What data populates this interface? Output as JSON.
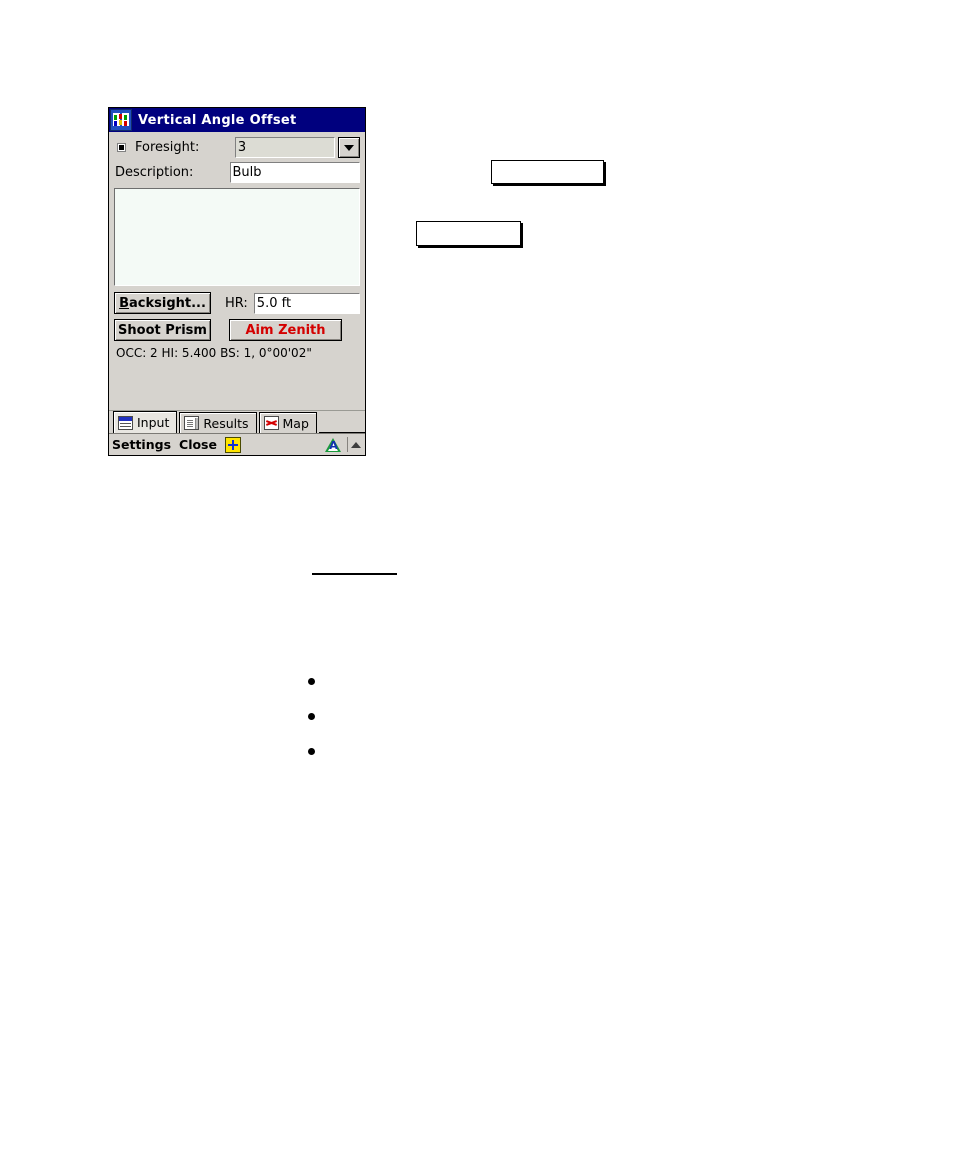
{
  "window": {
    "title": "Vertical Angle Offset",
    "title_icon": "app-book-icon"
  },
  "form": {
    "foresight": {
      "label": "Foresight:",
      "value": "3",
      "bullet_icon": "selected-square-icon",
      "dropdown_icon": "chevron-down-icon"
    },
    "description": {
      "label": "Description:",
      "value": "Bulb"
    },
    "list_area": {
      "name": "points-list",
      "items": []
    },
    "backsight_button": {
      "accel": "B",
      "rest": "acksight..."
    },
    "hr": {
      "label": "HR:",
      "value": "5.0 ft"
    },
    "shoot_prism_button": "Shoot Prism",
    "aim_zenith_button": "Aim Zenith",
    "status_line": "OCC: 2  HI: 5.400  BS: 1, 0°00'02\""
  },
  "tabs": [
    {
      "label": "Input",
      "icon": "form-input-icon",
      "active": true
    },
    {
      "label": "Results",
      "icon": "document-icon",
      "active": false
    },
    {
      "label": "Map",
      "icon": "map-points-icon",
      "active": false
    }
  ],
  "command_bar": {
    "settings_label": "Settings",
    "close_label": "Close",
    "star_icon": "blue-star-button-icon",
    "survey_icon": "survey-triangle-icon",
    "survey_icon_letter": "A",
    "expand_icon": "up-arrow-icon"
  },
  "annotations": {
    "callout_1": "",
    "callout_2": "",
    "underline_1": "",
    "bullets": [
      "",
      "",
      ""
    ]
  },
  "colors": {
    "titlebar": "#00007e",
    "dialog_bg": "#d6d3ce",
    "listbox_bg": "#f4faf6",
    "aim_zenith_text": "#d40000",
    "star_yellow": "#ffe400"
  }
}
